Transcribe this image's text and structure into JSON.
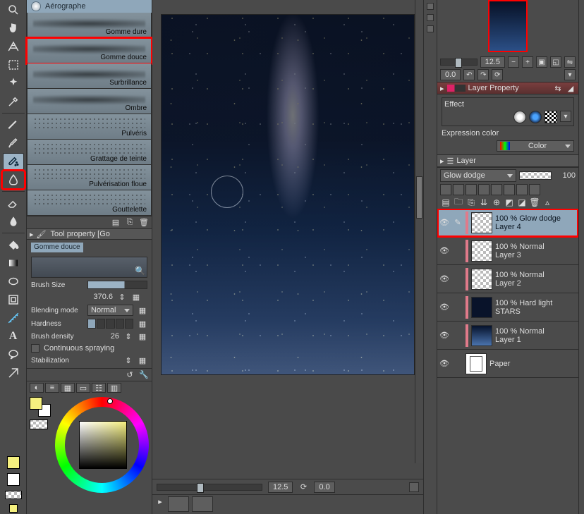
{
  "brush_panel": {
    "header": "Aérographe",
    "items": [
      {
        "label": "Gomme dure"
      },
      {
        "label": "Gomme douce",
        "highlight": true
      },
      {
        "label": "Surbrillance"
      },
      {
        "label": "Ombre"
      },
      {
        "label": "Pulvéris",
        "scatter": true
      },
      {
        "label": "Grattage de teinte",
        "scatter": true
      },
      {
        "label": "Pulvérisation floue",
        "scatter": true
      },
      {
        "label": "Gouttelette",
        "scatter": true
      }
    ]
  },
  "tool_prop": {
    "title_prefix": "Tool property [",
    "title_brush": "Go",
    "swatch": "Gomme douce",
    "brush_size_label": "Brush Size",
    "brush_size_value": "370.6",
    "blend_label": "Blending mode",
    "blend_value": "Normal",
    "hardness_label": "Hardness",
    "density_label": "Brush density",
    "density_value": "26",
    "continuous_label": "Continuous spraying",
    "stabilization_label": "Stabilization"
  },
  "nav": {
    "zoom": "12.5",
    "angle": "0.0"
  },
  "canvas_bar": {
    "zoom": "12.5",
    "angle": "0.0"
  },
  "layer_property": {
    "title": "Layer Property",
    "effect_label": "Effect",
    "expr_label": "Expression color",
    "expr_value": "Color"
  },
  "layer_panel": {
    "title": "Layer",
    "blend": "Glow dodge",
    "opacity": "100",
    "layers": [
      {
        "mode": "100 % Glow dodge",
        "name": "Layer 4",
        "highlight": true,
        "th": "checker"
      },
      {
        "mode": "100 % Normal",
        "name": "Layer 3",
        "th": "checker"
      },
      {
        "mode": "100 % Normal",
        "name": "Layer 2",
        "th": "checker"
      },
      {
        "mode": "100 % Hard light",
        "name": "STARS",
        "th": "stars"
      },
      {
        "mode": "100 % Normal",
        "name": "Layer 1",
        "th": "grad"
      },
      {
        "mode": "",
        "name": "Paper",
        "th": "paper"
      }
    ]
  }
}
